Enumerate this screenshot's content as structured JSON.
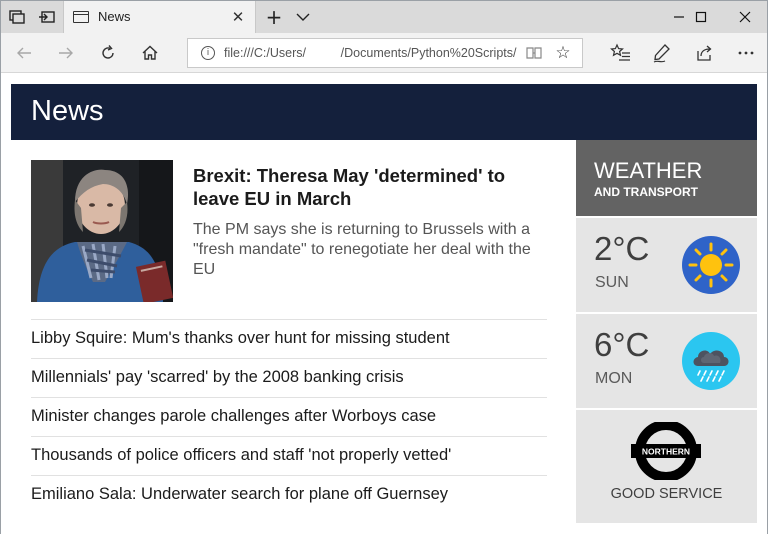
{
  "browser": {
    "tab": {
      "title": "News"
    },
    "address": {
      "url": "file:///C:/Users/          /Documents/Python%20Scripts/"
    },
    "icons": {
      "set_aside": "tabs-aside-icon",
      "show_tabs": "restore-tabs-icon",
      "page": "page-icon",
      "close_tab": "close-icon",
      "new_tab": "plus-icon",
      "tab_list": "chevron-down-icon",
      "back": "arrow-left-icon",
      "forward": "arrow-right-icon",
      "refresh": "refresh-icon",
      "home": "home-icon",
      "info": "info-icon",
      "reading": "book-icon",
      "favorite": "star-icon",
      "favorites_hub": "favorites-hub-icon",
      "notes": "pen-icon",
      "share": "share-icon",
      "more": "more-icon"
    }
  },
  "page": {
    "title": "News",
    "lead": {
      "headline": "Brexit: Theresa May 'determined' to leave EU in March",
      "summary": "The PM says she is returning to Brussels with a \"fresh mandate\" to renegotiate her deal with the EU"
    },
    "stories": [
      "Libby Squire: Mum's thanks over hunt for missing student",
      "Millennials' pay 'scarred' by the 2008 banking crisis",
      "Minister changes parole challenges after Worboys case",
      "Thousands of police officers and staff 'not properly vetted'",
      "Emiliano Sala: Underwater search for plane off Guernsey"
    ]
  },
  "sidebar": {
    "title": "WEATHER",
    "subtitle": "AND TRANSPORT",
    "weather": [
      {
        "temp": "2°C",
        "day": "SUN",
        "icon": "sun-icon"
      },
      {
        "temp": "6°C",
        "day": "MON",
        "icon": "rain-cloud-icon"
      }
    ],
    "transport": {
      "line": "NORTHERN",
      "status": "GOOD SERVICE",
      "icon": "underground-roundel-icon"
    }
  },
  "colors": {
    "header_bg": "#14203c",
    "weather_header_bg": "#636363",
    "card_bg": "#e5e5e5",
    "sun_bg": "#2f63c8",
    "sun": "#ffc20e",
    "rain_bg": "#2bc6f0"
  }
}
